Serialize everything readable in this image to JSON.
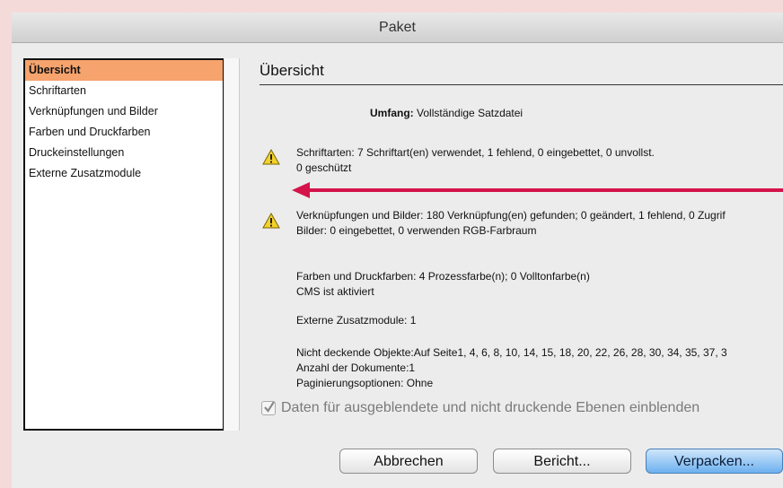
{
  "window": {
    "title": "Paket"
  },
  "sidebar": {
    "items": [
      {
        "label": "Übersicht",
        "selected": true
      },
      {
        "label": "Schriftarten",
        "selected": false
      },
      {
        "label": "Verknüpfungen und Bilder",
        "selected": false
      },
      {
        "label": "Farben und Druckfarben",
        "selected": false
      },
      {
        "label": "Druckeinstellungen",
        "selected": false
      },
      {
        "label": "Externe Zusatzmodule",
        "selected": false
      }
    ]
  },
  "main": {
    "title": "Übersicht",
    "scope_label": "Umfang:",
    "scope_value": "Vollständige Satzdatei",
    "fonts_line1": "Schriftarten: 7 Schriftart(en) verwendet, 1 fehlend, 0 eingebettet, 0 unvollst.",
    "fonts_line2": "0 geschützt",
    "links_line1": "Verknüpfungen und Bilder: 180 Verknüpfung(en) gefunden; 0 geändert, 1 fehlend, 0 Zugrif",
    "links_line2": "Bilder: 0 eingebettet, 0 verwenden RGB-Farbraum",
    "colors_line1": "Farben und Druckfarben: 4 Prozessfarbe(n); 0 Volltonfarbe(n)",
    "colors_line2": "CMS ist aktiviert",
    "plugins": "Externe Zusatzmodule: 1",
    "nonopaque": "Nicht deckende Objekte:Auf Seite1, 4, 6, 8, 10, 14, 15, 18, 20, 22, 26, 28, 30, 34, 35, 37, 3",
    "doc_count": "Anzahl der Dokumente:1",
    "pagination": "Paginierungsoptionen: Ohne",
    "checkbox_label": "Daten für ausgeblendete und nicht druckende Ebenen einblenden",
    "checkbox_checked": true
  },
  "buttons": {
    "cancel": "Abbrechen",
    "report": "Bericht...",
    "package": "Verpacken..."
  },
  "colors": {
    "selection": "#f6a36d",
    "arrow": "#d4144a",
    "primary_button": "#6db0ef"
  },
  "icons": {
    "warning": "warning-icon",
    "arrow": "arrow-left-icon"
  }
}
